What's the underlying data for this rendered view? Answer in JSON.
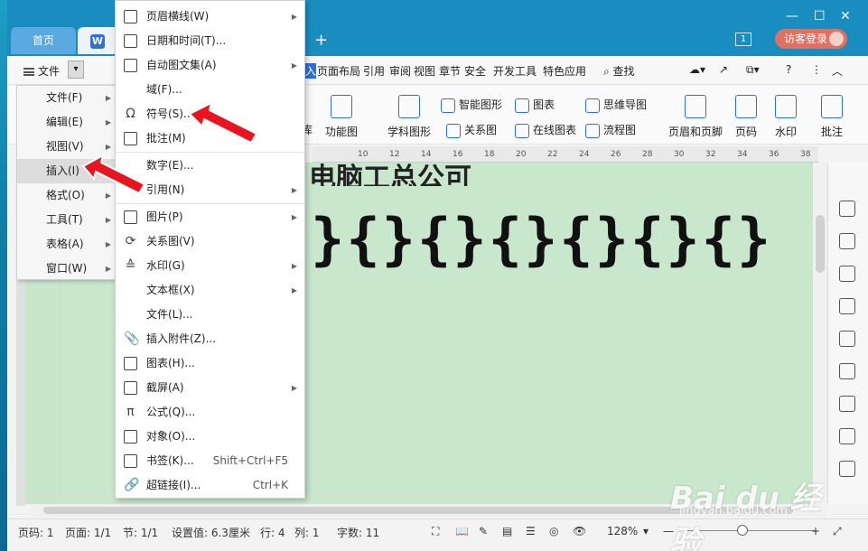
{
  "titlebar": {
    "tabs": [
      {
        "label": "首页"
      },
      {
        "label": "文"
      }
    ],
    "page_badge": "1",
    "login_label": "访客登录"
  },
  "menubar": {
    "file_label": "文件",
    "items": [
      "页面布局",
      "引用",
      "审阅",
      "视图",
      "章节",
      "安全",
      "开发工具",
      "特色应用"
    ],
    "search_label": "查找"
  },
  "ribbon": {
    "buttons": [
      "库",
      "功能图",
      "学科图形",
      "智能图形",
      "关系图",
      "图表",
      "在线图表",
      "思维导图",
      "流程图",
      "页眉和页脚",
      "页码",
      "水印",
      "批注"
    ]
  },
  "ruler": {
    "ticks": [
      "10",
      "12",
      "14",
      "16",
      "18",
      "20",
      "22",
      "24",
      "26",
      "28",
      "30",
      "32",
      "34",
      "36",
      "38"
    ]
  },
  "document": {
    "title": "电脑工总公可",
    "braces": "}{}{}{}{}{}{}"
  },
  "left_menu": {
    "items": [
      {
        "label": "文件(F)"
      },
      {
        "label": "编辑(E)"
      },
      {
        "label": "视图(V)"
      },
      {
        "label": "插入(I)"
      },
      {
        "label": "格式(O)"
      },
      {
        "label": "工具(T)"
      },
      {
        "label": "表格(A)"
      },
      {
        "label": "窗口(W)"
      }
    ]
  },
  "insert_menu": {
    "items": [
      {
        "label": "页眉横线(W)"
      },
      {
        "label": "日期和时间(T)..."
      },
      {
        "label": "自动图文集(A)"
      },
      {
        "label": "域(F)..."
      },
      {
        "label": "符号(S)..."
      },
      {
        "label": "批注(M)"
      },
      {
        "label": "数字(E)..."
      },
      {
        "label": "引用(N)"
      },
      {
        "label": "图片(P)"
      },
      {
        "label": "关系图(V)"
      },
      {
        "label": "水印(G)"
      },
      {
        "label": "文本框(X)"
      },
      {
        "label": "文件(L)..."
      },
      {
        "label": "插入附件(Z)..."
      },
      {
        "label": "图表(H)..."
      },
      {
        "label": "截屏(A)"
      },
      {
        "label": "公式(Q)..."
      },
      {
        "label": "对象(O)..."
      },
      {
        "label": "书签(K)...",
        "shortcut": "Shift+Ctrl+F5"
      },
      {
        "label": "超链接(I)...",
        "shortcut": "Ctrl+K"
      }
    ]
  },
  "statusbar": {
    "page_num": "页码: 1",
    "pages": "页面: 1/1",
    "section": "节: 1/1",
    "setting": "设置值: 6.3厘米",
    "row": "行: 4",
    "col": "列: 1",
    "words": "字数: 11",
    "zoom": "128%"
  },
  "watermark": {
    "main": "Bai du 经验",
    "sub": "jingyan.baidu.com"
  },
  "colors": {
    "titlebar": "#1a8dc0",
    "accent": "#2f6fd8",
    "doc_bg": "#c9e7cc",
    "arrow": "#e8141e"
  }
}
